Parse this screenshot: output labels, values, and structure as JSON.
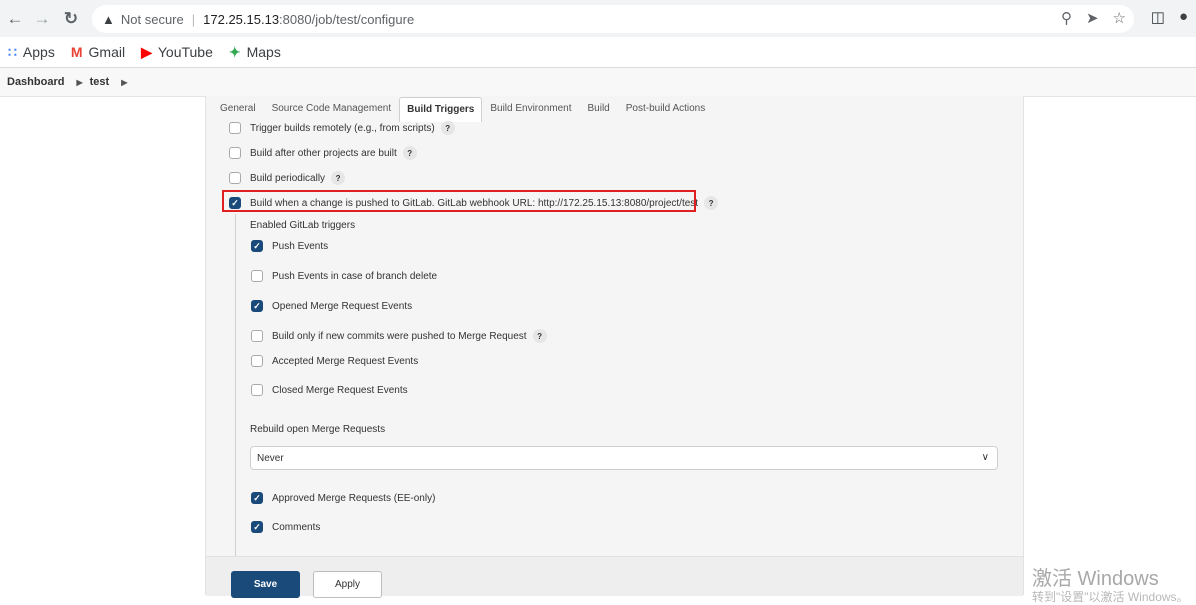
{
  "browser": {
    "url_security": "Not secure",
    "url_host": "172.25.15.13",
    "url_path": ":8080/job/test/configure",
    "bookmarks": [
      {
        "icon": "apps-grid-icon",
        "label": "Apps"
      },
      {
        "icon": "gmail-icon",
        "label": "Gmail"
      },
      {
        "icon": "youtube-icon",
        "label": "YouTube"
      },
      {
        "icon": "maps-icon",
        "label": "Maps"
      }
    ]
  },
  "breadcrumb": {
    "items": [
      "Dashboard",
      "test"
    ]
  },
  "tabs": [
    "General",
    "Source Code Management",
    "Build Triggers",
    "Build Environment",
    "Build",
    "Post-build Actions"
  ],
  "active_tab": "Build Triggers",
  "triggers": [
    {
      "label": "Trigger builds remotely (e.g., from scripts)",
      "checked": false,
      "help": "?"
    },
    {
      "label": "Build after other projects are built",
      "checked": false,
      "help": "?"
    },
    {
      "label": "Build periodically",
      "checked": false,
      "help": "?"
    },
    {
      "label": "Build when a change is pushed to GitLab. GitLab webhook URL: http://172.25.15.13:8080/project/test",
      "checked": true,
      "help": "?"
    }
  ],
  "gitlab": {
    "enabled_triggers_label": "Enabled GitLab triggers",
    "options": [
      {
        "label": "Push Events",
        "checked": true
      },
      {
        "label": "Push Events in case of branch delete",
        "checked": false
      },
      {
        "label": "Opened Merge Request Events",
        "checked": true
      },
      {
        "label": "Build only if new commits were pushed to Merge Request",
        "checked": false,
        "help": "?"
      },
      {
        "label": "Accepted Merge Request Events",
        "checked": false
      },
      {
        "label": "Closed Merge Request Events",
        "checked": false
      }
    ],
    "rebuild_label": "Rebuild open Merge Requests",
    "rebuild_value": "Never",
    "extra_options": [
      {
        "label": "Approved Merge Requests (EE-only)",
        "checked": true
      },
      {
        "label": "Comments",
        "checked": true
      }
    ]
  },
  "buttons": {
    "save": "Save",
    "apply": "Apply"
  },
  "watermark": {
    "title": "激活 Windows",
    "subtitle": "转到\"设置\"以激活 Windows。"
  }
}
